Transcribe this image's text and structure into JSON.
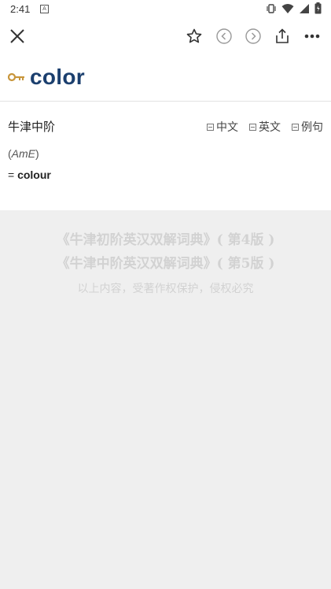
{
  "status_bar": {
    "time": "2:41",
    "badge": "A"
  },
  "toolbar": {
    "close_icon": "close-icon",
    "favorite_icon": "star-icon",
    "prev_icon": "chevron-left-icon",
    "next_icon": "chevron-right-icon",
    "share_icon": "share-icon",
    "more_icon": "more-icon"
  },
  "entry": {
    "key_icon": "key-icon",
    "key_color": "#c8963c",
    "headword": "color",
    "headword_color": "#1b3f6e"
  },
  "dictionary": {
    "name": "牛津中阶",
    "toggles": [
      "中文",
      "英文",
      "例句"
    ]
  },
  "definition": {
    "region_open": "(",
    "region": "AmE",
    "region_close": ")",
    "equals": "=",
    "xref": "colour"
  },
  "copyright": {
    "line1": "《牛津初阶英汉双解词典》( 第4版 )",
    "line2": "《牛津中阶英汉双解词典》( 第5版 )",
    "notice": "以上内容，受著作权保护，侵权必究"
  }
}
